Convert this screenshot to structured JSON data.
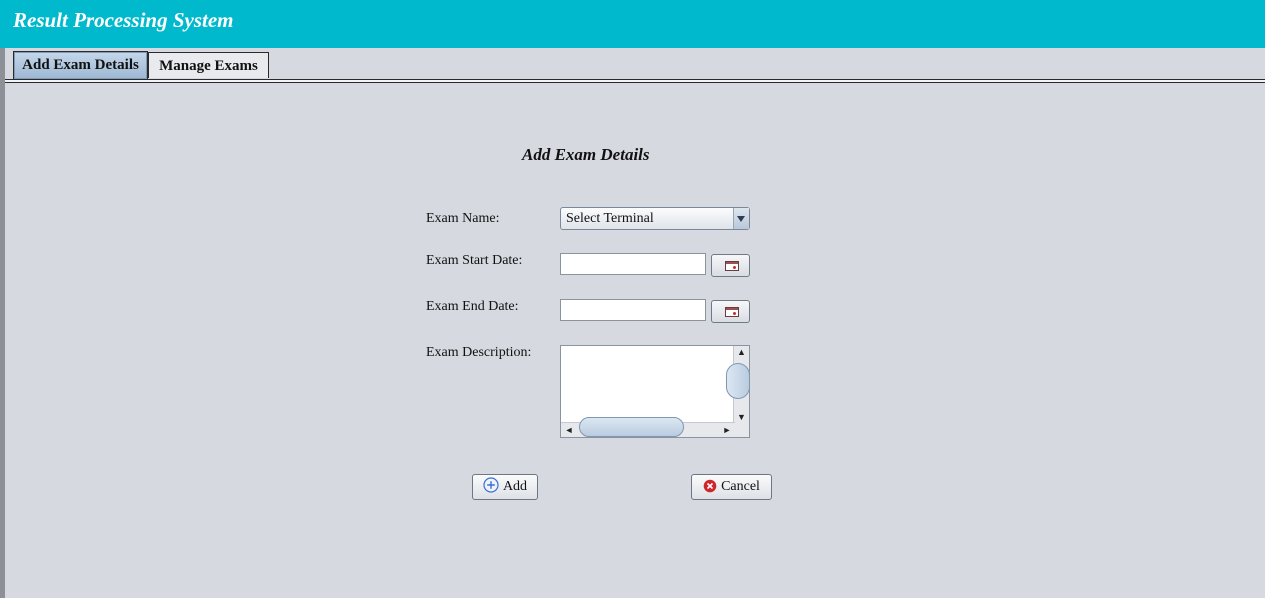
{
  "app": {
    "title": "Result Processing System"
  },
  "tabs": [
    {
      "label": "Add Exam Details",
      "active": true
    },
    {
      "label": "Manage Exams",
      "active": false
    }
  ],
  "form": {
    "title": "Add Exam Details",
    "exam_name_label": "Exam Name:",
    "exam_name_value": "Select Terminal",
    "start_date_label": "Exam Start Date:",
    "start_date_value": "",
    "end_date_label": "Exam End Date:",
    "end_date_value": "",
    "description_label": "Exam Description:",
    "description_value": ""
  },
  "buttons": {
    "add_label": "Add",
    "add_icon": "plus-circle-icon",
    "cancel_label": "Cancel",
    "cancel_icon": "cancel-circle-icon",
    "calendar_icon": "calendar-icon"
  },
  "colors": {
    "header": "#00b9cc",
    "background": "#d6d9e0",
    "cancel_icon": "#d0262b",
    "add_icon": "#3a6fd0"
  }
}
